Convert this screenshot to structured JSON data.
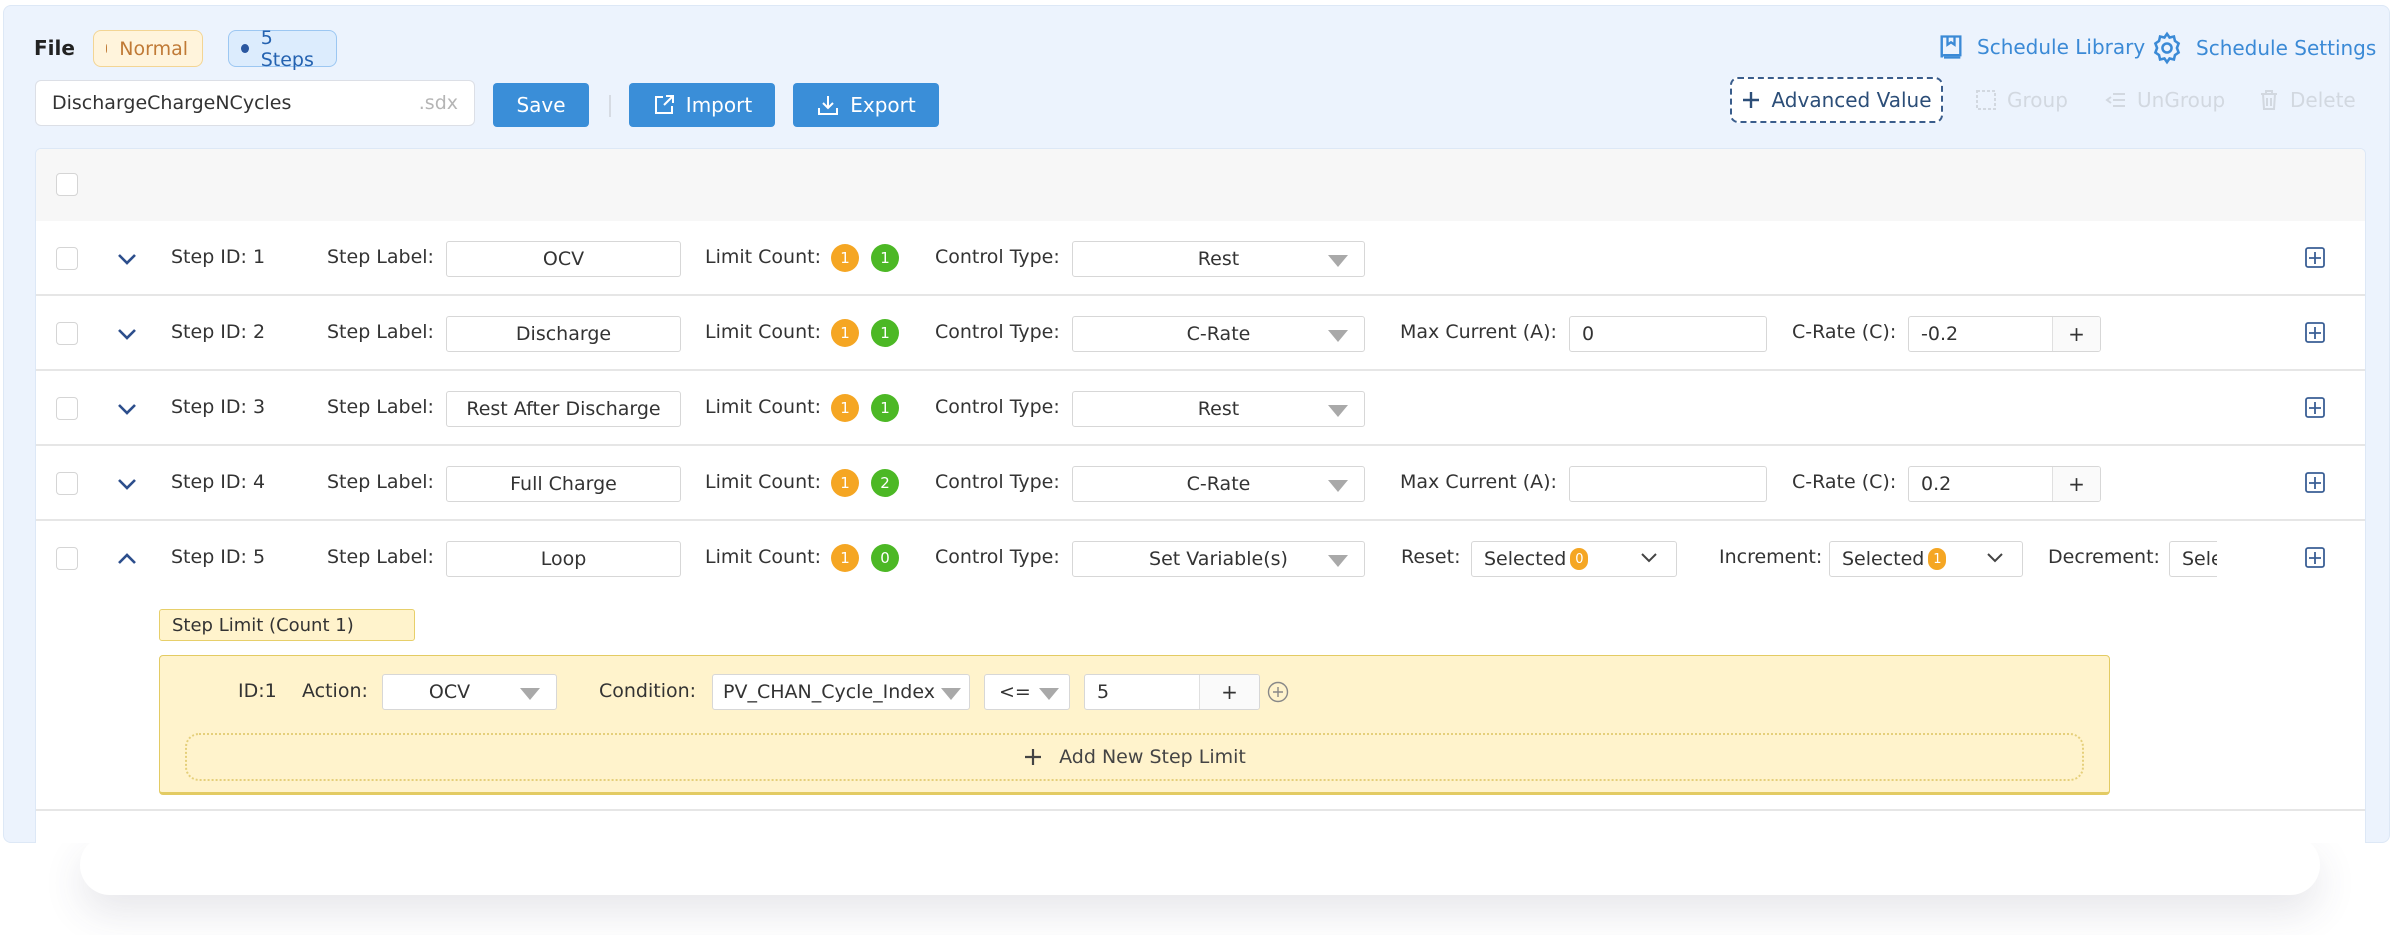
{
  "header": {
    "file_label": "File",
    "status_badge": "Normal",
    "steps_badge": "5 Steps",
    "filename": "DischargeChargeNCycles",
    "file_extension": ".sdx",
    "save_label": "Save",
    "import_label": "Import",
    "export_label": "Export",
    "schedule_library_label": "Schedule Library",
    "schedule_settings_label": "Schedule Settings",
    "advanced_value_label": "Advanced Value",
    "group_label": "Group",
    "ungroup_label": "UnGroup",
    "delete_label": "Delete"
  },
  "labels": {
    "step_id": "Step ID:",
    "step_label": "Step Label:",
    "limit_count": "Limit Count:",
    "control_type": "Control Type:",
    "max_current": "Max Current (A):",
    "c_rate": "C-Rate (C):",
    "reset": "Reset:",
    "increment": "Increment:",
    "decrement": "Decrement:",
    "addon_plus": "+"
  },
  "steps": [
    {
      "id": "Step ID: 1",
      "label": "OCV",
      "limit_orange": "1",
      "limit_green": "1",
      "control_type": "Rest",
      "expanded": false
    },
    {
      "id": "Step ID: 2",
      "label": "Discharge",
      "limit_orange": "1",
      "limit_green": "1",
      "control_type": "C-Rate",
      "max_current": "0",
      "c_rate": "-0.2",
      "expanded": false
    },
    {
      "id": "Step ID: 3",
      "label": "Rest After Discharge",
      "limit_orange": "1",
      "limit_green": "1",
      "control_type": "Rest",
      "expanded": false
    },
    {
      "id": "Step ID: 4",
      "label": "Full Charge",
      "limit_orange": "1",
      "limit_green": "2",
      "control_type": "C-Rate",
      "max_current": "",
      "c_rate": "0.2",
      "expanded": false
    },
    {
      "id": "Step ID: 5",
      "label": "Loop",
      "limit_orange": "1",
      "limit_green": "0",
      "control_type": "Set Variable(s)",
      "reset_value": "Selected",
      "reset_count": "0",
      "increment_value": "Selected",
      "increment_count": "1",
      "decrement_value": "Sele",
      "expanded": true
    }
  ],
  "step_limits": {
    "title": "Step Limit (Count 1)",
    "items": [
      {
        "id": "ID:1",
        "action_label": "Action:",
        "action": "OCV",
        "condition_label": "Condition:",
        "condition": "PV_CHAN_Cycle_Index",
        "operator": "<=",
        "value": "5"
      }
    ],
    "add_label": "Add New Step Limit"
  },
  "colors": {
    "primary": "#3a8ed8",
    "link": "#3b8ad6",
    "orange_count": "#f5a623",
    "green_count": "#4cb825",
    "limit_bg": "#fff3cc"
  }
}
